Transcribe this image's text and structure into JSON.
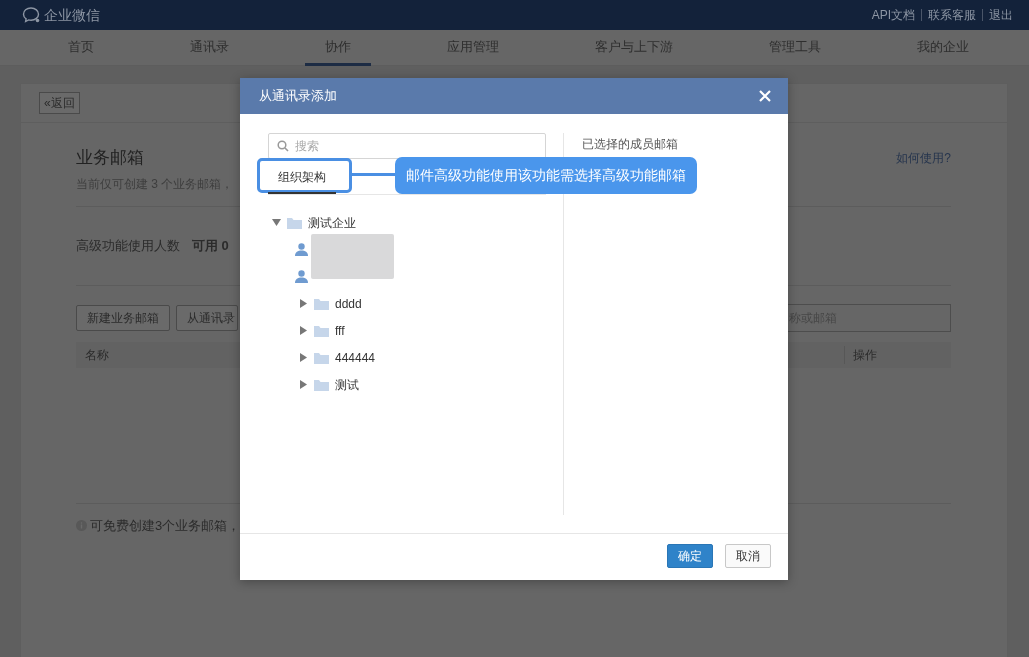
{
  "topbar": {
    "logo": "企业微信",
    "links": [
      "API文档",
      "联系客服",
      "退出"
    ]
  },
  "nav": [
    {
      "label": "首页",
      "selected": false
    },
    {
      "label": "通讯录",
      "selected": false
    },
    {
      "label": "协作",
      "selected": true
    },
    {
      "label": "应用管理",
      "selected": false
    },
    {
      "label": "客户与上下游",
      "selected": false
    },
    {
      "label": "管理工具",
      "selected": false
    },
    {
      "label": "我的企业",
      "selected": false
    }
  ],
  "page": {
    "back": "«返回",
    "title": "业务邮箱",
    "subtitle": "当前仅可创建 3 个业务邮箱，",
    "help_link": "如何使用?",
    "usage_label": "高级功能使用人数",
    "usage_value": "可用 0",
    "buttons": [
      "新建业务邮箱",
      "从通讯录"
    ],
    "search_placeholder": "称或邮箱",
    "columns": [
      {
        "label": "名称"
      },
      {
        "label": "操作"
      }
    ],
    "note": "可免费创建3个业务邮箱，"
  },
  "modal": {
    "title": "从通讯录添加",
    "search_placeholder": "搜索",
    "tabs": [
      {
        "label": "组织架构",
        "selected": true
      }
    ],
    "tree": [
      {
        "kind": "department",
        "label": "测试企业",
        "expanded": true,
        "children": [
          {
            "kind": "person"
          },
          {
            "kind": "person"
          },
          {
            "kind": "department",
            "label": "dddd",
            "expanded": false
          },
          {
            "kind": "department",
            "label": "fff",
            "expanded": false
          },
          {
            "kind": "department",
            "label": "444444",
            "expanded": false
          },
          {
            "kind": "department",
            "label": "测试",
            "expanded": false
          }
        ]
      }
    ],
    "selected_heading": "已选择的成员邮箱",
    "buttons": [
      {
        "label": "确定",
        "kind": "primary"
      },
      {
        "label": "取消",
        "kind": "secondary"
      }
    ]
  },
  "callout": {
    "text": "邮件高级功能使用该功能需选择高级功能邮箱"
  }
}
